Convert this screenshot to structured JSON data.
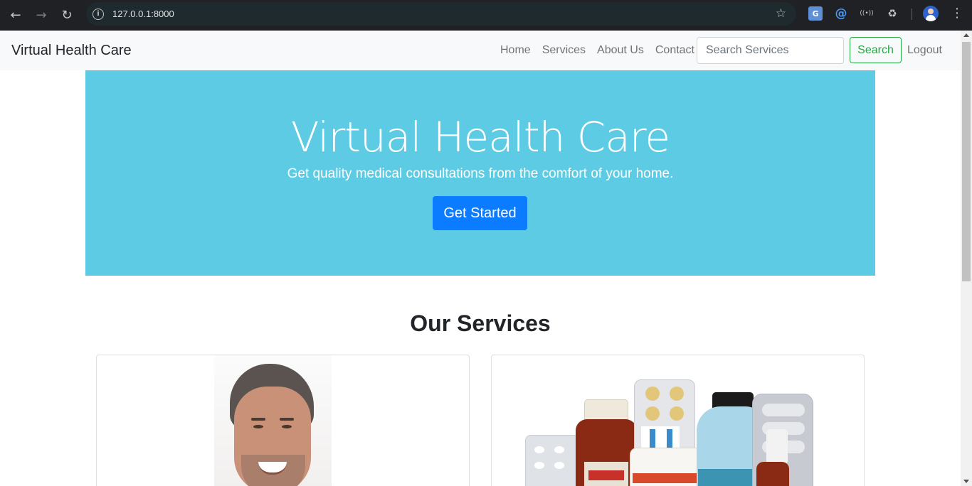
{
  "browser": {
    "url": "127.0.0.1:8000",
    "icons": [
      "back-icon",
      "forward-icon",
      "reload-icon",
      "info-icon",
      "star-icon",
      "translate-icon",
      "at-icon",
      "radio-icon",
      "puzzle-icon",
      "profile-avatar",
      "menu-icon"
    ]
  },
  "navbar": {
    "brand": "Virtual Health Care",
    "links": [
      "Home",
      "Services",
      "About Us",
      "Contact"
    ],
    "search_placeholder": "Search Services",
    "search_label": "Search",
    "logout_label": "Logout"
  },
  "hero": {
    "title": "Virtual Health Care",
    "subtitle": "Get quality medical consultations from the comfort of your home.",
    "cta_label": "Get Started",
    "bg_color": "#5dcbe4",
    "cta_color": "#0b7cff"
  },
  "services": {
    "title": "Our Services",
    "cards": [
      {
        "image": "doctor-portrait"
      },
      {
        "image": "medicine-bottles"
      }
    ]
  }
}
